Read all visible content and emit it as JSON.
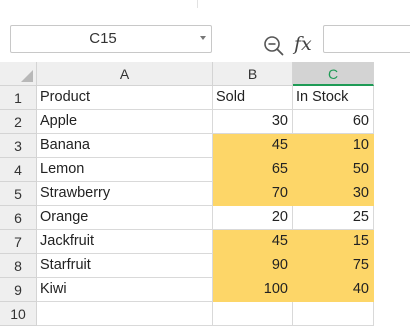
{
  "formula_bar": {
    "name_box": "C15",
    "fx_label": "fx",
    "formula_value": "",
    "icons": {
      "zoom": "zoom-icon",
      "function": "fx-icon",
      "dropdown": "chevron-down-icon"
    }
  },
  "columns": [
    {
      "label": "A",
      "selected": false
    },
    {
      "label": "B",
      "selected": false
    },
    {
      "label": "C",
      "selected": true
    }
  ],
  "rows": [
    {
      "num": "1",
      "a": "Product",
      "b": "Sold",
      "c": "In Stock",
      "highlight": false
    },
    {
      "num": "2",
      "a": "Apple",
      "b": "30",
      "c": "60",
      "highlight": false
    },
    {
      "num": "3",
      "a": "Banana",
      "b": "45",
      "c": "10",
      "highlight": true
    },
    {
      "num": "4",
      "a": "Lemon",
      "b": "65",
      "c": "50",
      "highlight": true
    },
    {
      "num": "5",
      "a": "Strawberry",
      "b": "70",
      "c": "30",
      "highlight": true
    },
    {
      "num": "6",
      "a": "Orange",
      "b": "20",
      "c": "25",
      "highlight": false
    },
    {
      "num": "7",
      "a": "Jackfruit",
      "b": "45",
      "c": "15",
      "highlight": true
    },
    {
      "num": "8",
      "a": "Starfruit",
      "b": "90",
      "c": "75",
      "highlight": true
    },
    {
      "num": "9",
      "a": "Kiwi",
      "b": "100",
      "c": "40",
      "highlight": true
    },
    {
      "num": "10",
      "a": "",
      "b": "",
      "c": "",
      "highlight": false
    }
  ],
  "colors": {
    "highlight": "#fdd668",
    "accent": "#1f9b56",
    "header_bg": "#efefef",
    "selected_header_bg": "#d3d3d3"
  }
}
